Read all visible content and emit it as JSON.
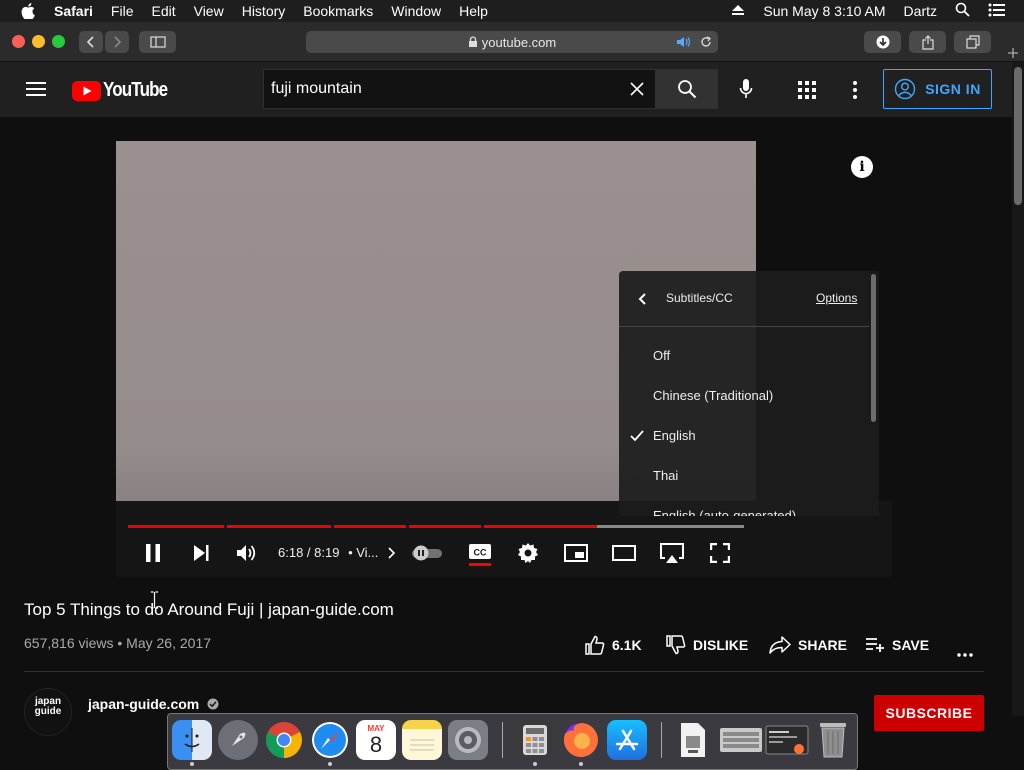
{
  "menubar": {
    "app": "Safari",
    "items": [
      "File",
      "Edit",
      "View",
      "History",
      "Bookmarks",
      "Window",
      "Help"
    ],
    "datetime": "Sun May 8  3:10 AM",
    "user": "Dartz"
  },
  "browser": {
    "url": "youtube.com"
  },
  "youtube": {
    "logo_text": "YouTube",
    "search_value": "fuji mountain",
    "signin_label": "SIGN IN"
  },
  "player": {
    "time": "6:18 / 8:19",
    "chapter": "• Vi...",
    "progress_fraction": 0.7585,
    "subtitles_menu": {
      "title": "Subtitles/CC",
      "options_link": "Options",
      "options": [
        "Off",
        "Chinese (Traditional)",
        "English",
        "Thai",
        "English (auto-generated)"
      ],
      "selected": "English"
    }
  },
  "video": {
    "title": "Top 5 Things to do Around Fuji | japan-guide.com",
    "meta": "657,816 views • May 26, 2017",
    "like_count": "6.1K",
    "dislike_label": "DISLIKE",
    "share_label": "SHARE",
    "save_label": "SAVE"
  },
  "channel": {
    "name": "japan-guide.com",
    "avatar_text": "japan guide",
    "subscribe_label": "SUBSCRIBE"
  },
  "dock": {
    "apps": [
      "finder-icon",
      "launchpad-icon",
      "chrome-icon",
      "safari-icon",
      "calendar-icon",
      "notes-icon",
      "system-preferences-icon",
      "calculator-icon",
      "firefox-icon",
      "app-store-icon",
      "preview-icon",
      "keyboard-viewer-icon",
      "terminal-icon",
      "trash-icon"
    ],
    "calendar_month": "MAY",
    "calendar_day": "8"
  },
  "colors": {
    "youtube_red": "#ff0000",
    "accent_blue": "#3ea6ff",
    "progress_red": "#ee0000"
  }
}
